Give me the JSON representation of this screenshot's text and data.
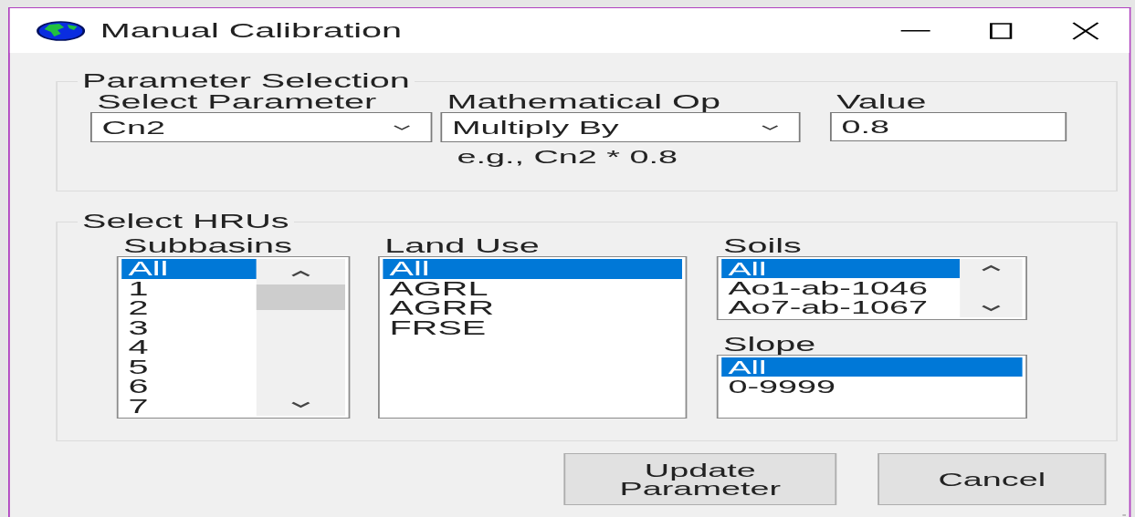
{
  "window": {
    "title": "Manual Calibration"
  },
  "parameter_selection": {
    "title": "Parameter Selection",
    "select_parameter": {
      "label": "Select Parameter",
      "value": "Cn2"
    },
    "mathematical_op": {
      "label": "Mathematical Op",
      "value": "Multiply By"
    },
    "value": {
      "label": "Value",
      "value": "0.8"
    },
    "hint": "e.g., Cn2 * 0.8"
  },
  "select_hrus": {
    "title": "Select HRUs",
    "subbasins": {
      "label": "Subbasins",
      "items": [
        {
          "text": "All",
          "selected": true
        },
        {
          "text": "1",
          "selected": false
        },
        {
          "text": "2",
          "selected": false
        },
        {
          "text": "3",
          "selected": false
        },
        {
          "text": "4",
          "selected": false
        },
        {
          "text": "5",
          "selected": false
        },
        {
          "text": "6",
          "selected": false
        },
        {
          "text": "7",
          "selected": false
        }
      ]
    },
    "land_use": {
      "label": "Land Use",
      "items": [
        {
          "text": "All",
          "selected": true
        },
        {
          "text": "AGRL",
          "selected": false
        },
        {
          "text": "AGRR",
          "selected": false
        },
        {
          "text": "FRSE",
          "selected": false
        }
      ]
    },
    "soils": {
      "label": "Soils",
      "items": [
        {
          "text": "All",
          "selected": true
        },
        {
          "text": "Ao1-ab-1046",
          "selected": false
        },
        {
          "text": "Ao7-ab-1067",
          "selected": false
        }
      ]
    },
    "slope": {
      "label": "Slope",
      "items": [
        {
          "text": "All",
          "selected": true
        },
        {
          "text": "0-9999",
          "selected": false
        }
      ]
    }
  },
  "buttons": [
    "Update Parameter",
    "Cancel"
  ]
}
